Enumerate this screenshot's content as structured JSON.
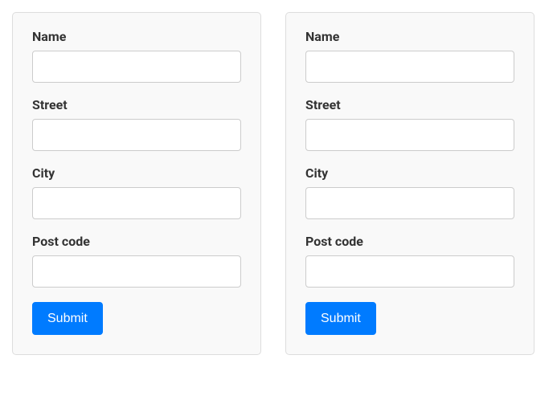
{
  "forms": [
    {
      "fields": [
        {
          "label": "Name",
          "value": ""
        },
        {
          "label": "Street",
          "value": ""
        },
        {
          "label": "City",
          "value": ""
        },
        {
          "label": "Post code",
          "value": ""
        }
      ],
      "submit_label": "Submit"
    },
    {
      "fields": [
        {
          "label": "Name",
          "value": ""
        },
        {
          "label": "Street",
          "value": ""
        },
        {
          "label": "City",
          "value": ""
        },
        {
          "label": "Post code",
          "value": ""
        }
      ],
      "submit_label": "Submit"
    }
  ]
}
